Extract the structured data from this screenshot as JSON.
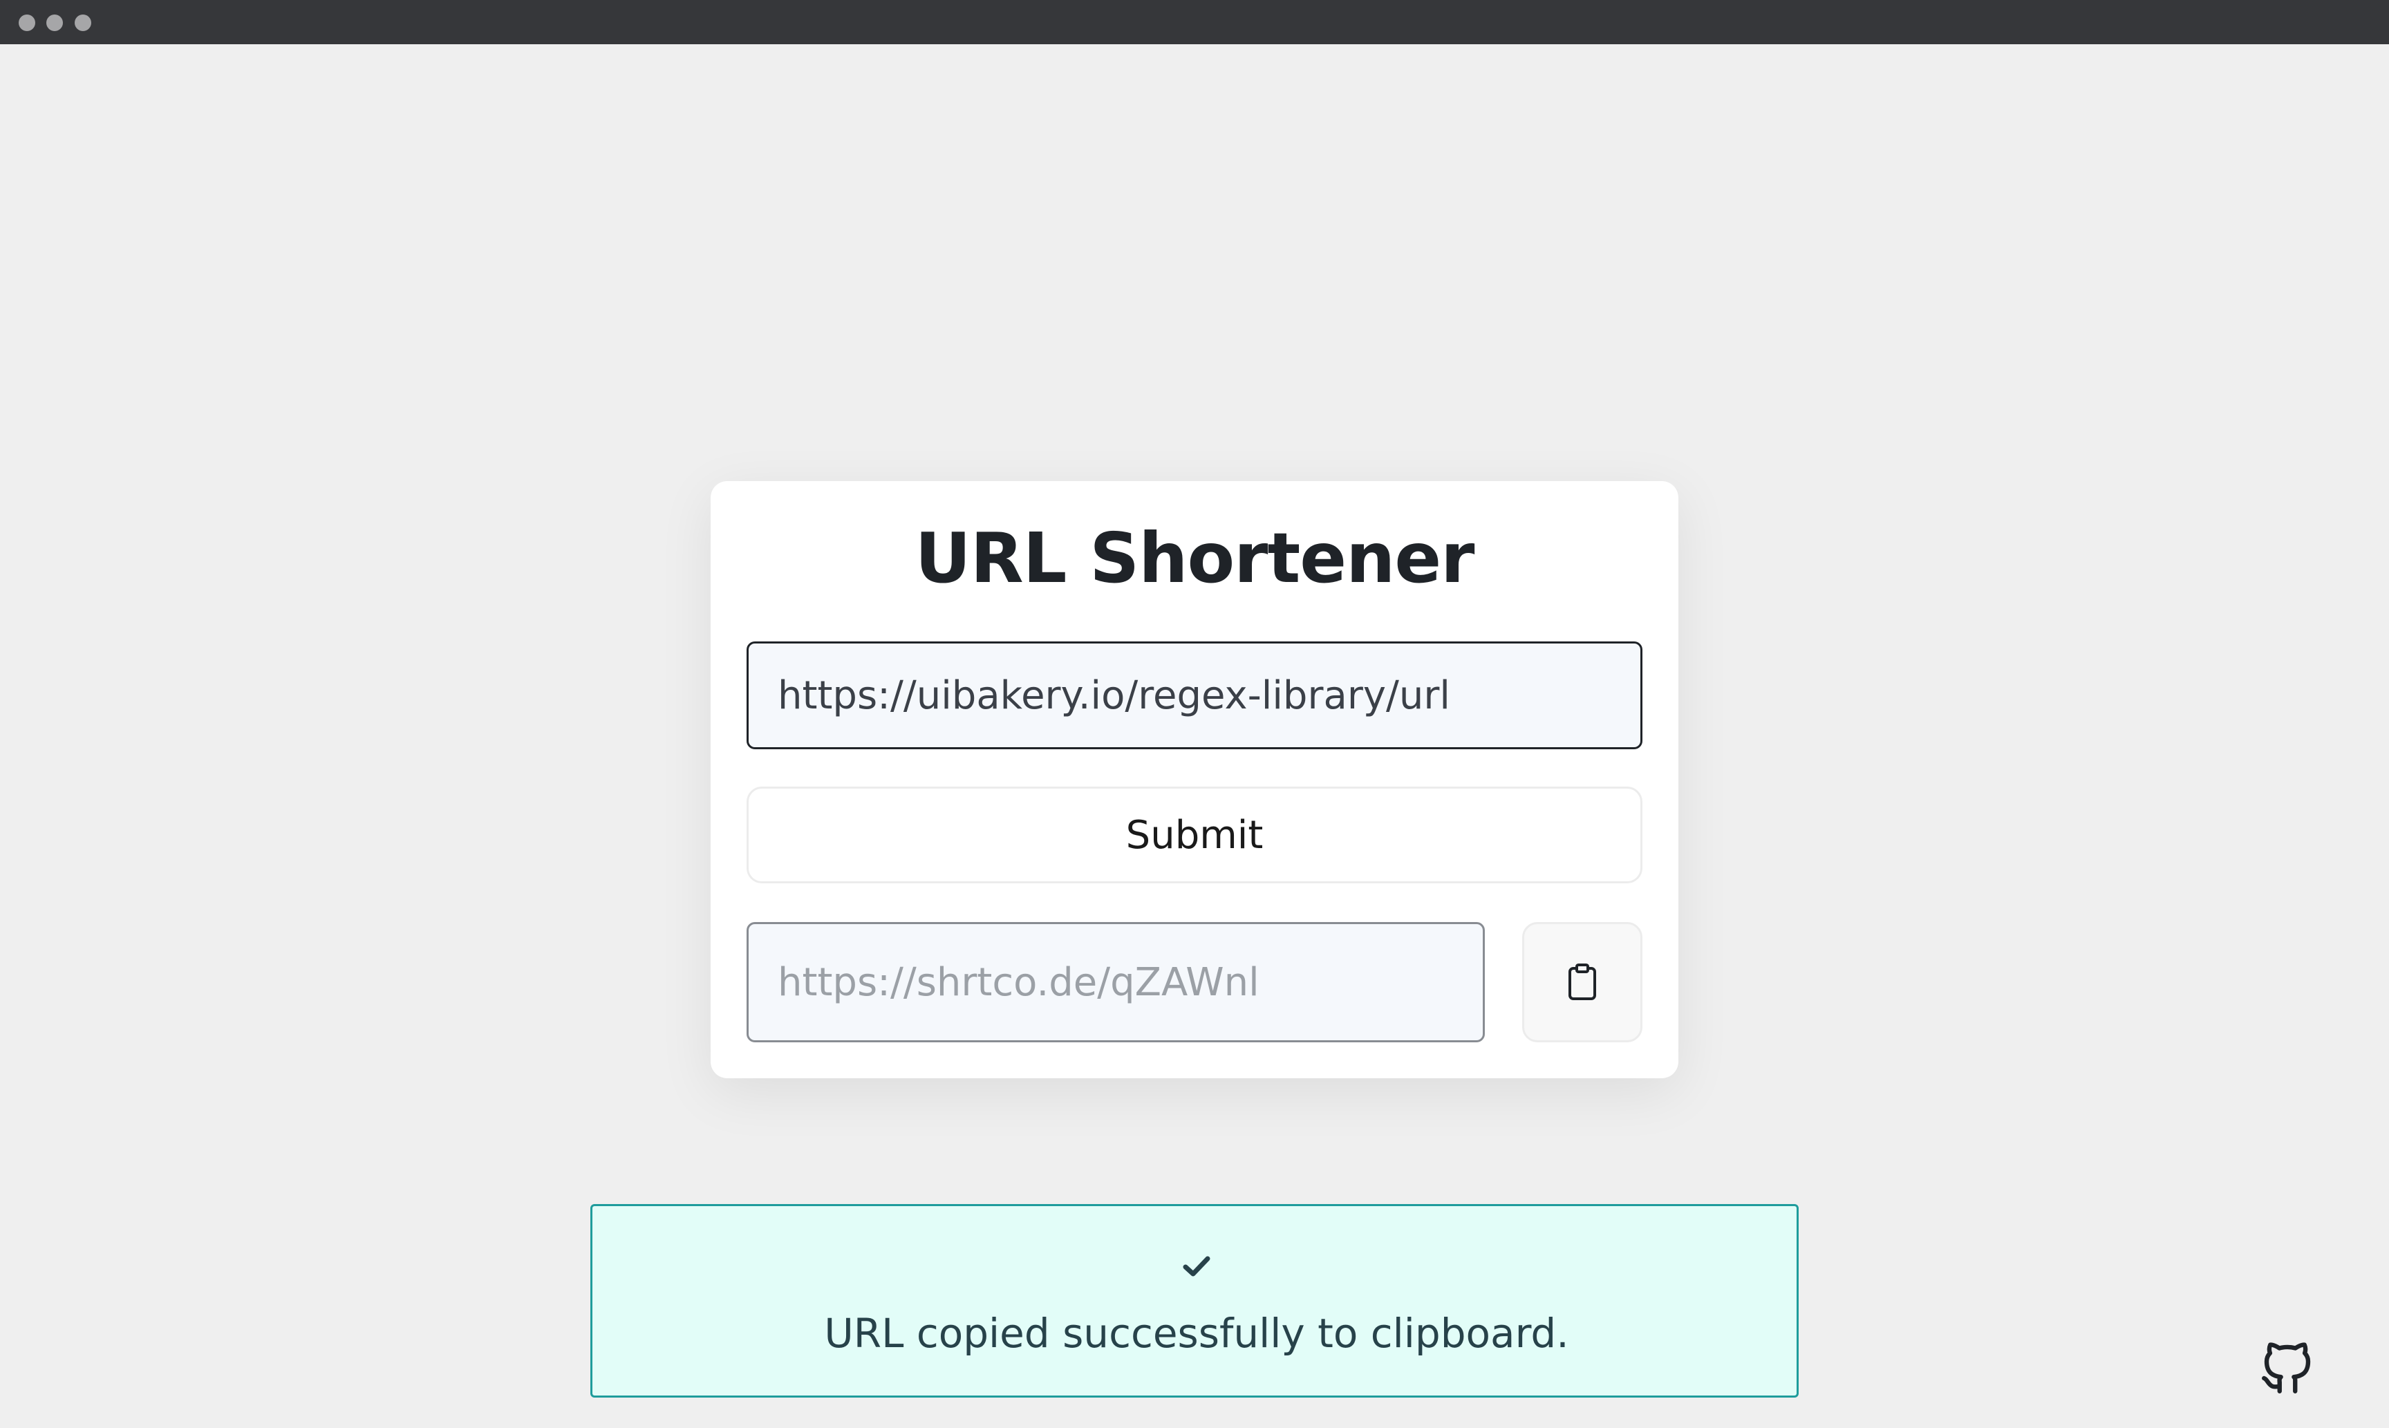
{
  "window": {
    "controls": [
      "close",
      "minimize",
      "maximize"
    ]
  },
  "app": {
    "title": "URL Shortener"
  },
  "form": {
    "url_value": "https://uibakery.io/regex-library/url",
    "submit_label": "Submit",
    "short_url_placeholder": "https://shrtco.de/qZAWnl",
    "copy_icon": "clipboard-icon"
  },
  "toast": {
    "icon": "check-icon",
    "message": "URL copied successfully to clipboard."
  },
  "footer": {
    "github_icon": "github-icon"
  },
  "colors": {
    "background": "#efefef",
    "titlebar": "#36373a",
    "card": "#ffffff",
    "toast_background": "#e2fdf8",
    "toast_border": "#1f9c9c",
    "title_text": "#1f2328"
  }
}
